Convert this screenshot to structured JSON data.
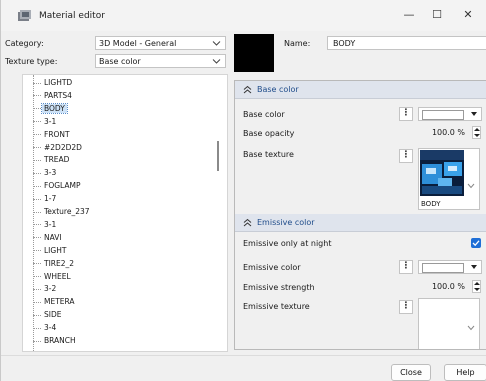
{
  "window": {
    "title": "Material editor",
    "minimize": "—",
    "maximize": "☐",
    "close": "✕"
  },
  "category": {
    "label": "Category:",
    "value": "3D Model - General"
  },
  "texture_type": {
    "label": "Texture type:",
    "value": "Base color"
  },
  "tree": {
    "items": [
      "LIGHTD",
      "PARTS4",
      "BODY",
      "3-1",
      "FRONT",
      "#2D2D2D",
      "TREAD",
      "3-3",
      "FOGLAMP",
      "1-7",
      "Texture_237",
      "3-1",
      "NAVI",
      "LIGHT",
      "TIRE2_2",
      "WHEEL",
      "3-2",
      "METERA",
      "SIDE",
      "3-4",
      "BRANCH"
    ],
    "selected_index": 2
  },
  "name": {
    "label": "Name:",
    "value": "BODY"
  },
  "base_section": {
    "title": "Base color",
    "base_color_label": "Base color",
    "base_opacity_label": "Base opacity",
    "base_opacity_value": "100.0 %",
    "base_texture_label": "Base texture",
    "base_texture_caption": "BODY",
    "dots": "⋮"
  },
  "emissive_section": {
    "title": "Emissive color",
    "night_label": "Emissive only at night",
    "night_checked": true,
    "color_label": "Emissive color",
    "strength_label": "Emissive strength",
    "strength_value": "100.0 %",
    "texture_label": "Emissive texture",
    "dots": "⋮"
  },
  "buttons": {
    "close": "Close",
    "help": "Help"
  },
  "colors": {
    "accent": "#1f6fd6",
    "section_header": "#dfe4ed",
    "section_text": "#1f4c8a"
  }
}
